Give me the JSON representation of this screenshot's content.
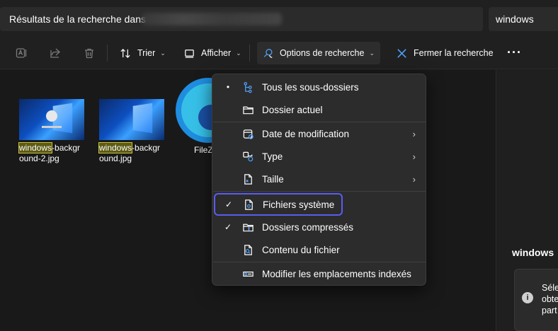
{
  "address_bar": {
    "prefix": "Résultats de la recherche dans",
    "search_value": "windows"
  },
  "toolbar": {
    "copy_icon": "rename-icon",
    "share_icon": "share-icon",
    "delete_icon": "delete-icon",
    "sort_label": "Trier",
    "view_label": "Afficher",
    "search_options_label": "Options de recherche",
    "close_search_label": "Fermer la recherche",
    "more_label": "···"
  },
  "files": [
    {
      "highlight": "windows",
      "rest": "-background-2.jpg"
    },
    {
      "highlight": "windows",
      "rest": "-background.jpg"
    },
    {
      "label": "FileZ"
    }
  ],
  "menu": {
    "items": [
      {
        "mark": "•",
        "icon": "subfolders-icon",
        "label": "Tous les sous-dossiers",
        "submenu": false
      },
      {
        "mark": "",
        "icon": "folder-icon",
        "label": "Dossier actuel",
        "submenu": false
      },
      {
        "mark": "",
        "icon": "calendar-icon",
        "label": "Date de modification",
        "submenu": true
      },
      {
        "mark": "",
        "icon": "type-icon",
        "label": "Type",
        "submenu": true
      },
      {
        "mark": "",
        "icon": "file-size-icon",
        "label": "Taille",
        "submenu": true
      },
      {
        "mark": "✓",
        "icon": "system-file-icon",
        "label": "Fichiers système",
        "submenu": false
      },
      {
        "mark": "✓",
        "icon": "zip-folder-icon",
        "label": "Dossiers compressés",
        "submenu": false
      },
      {
        "mark": "",
        "icon": "file-content-icon",
        "label": "Contenu du fichier",
        "submenu": false
      },
      {
        "mark": "",
        "icon": "index-icon",
        "label": "Modifier les emplacements indexés",
        "submenu": false
      }
    ],
    "submenu_glyph": "›"
  },
  "details_pane": {
    "title": "windows",
    "info_text": "Séle\nobte\npart"
  },
  "colors": {
    "focus_ring": "#5a5cf0",
    "highlight_bg": "#5c5a14",
    "accent_blue": "#4ea1ff"
  }
}
